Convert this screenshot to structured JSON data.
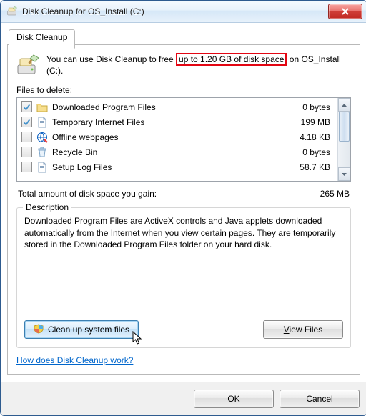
{
  "window": {
    "title": "Disk Cleanup for OS_Install (C:)"
  },
  "tab": {
    "label": "Disk Cleanup"
  },
  "intro": {
    "before": "You can use Disk Cleanup to free",
    "highlight": "up to 1.20 GB of disk space",
    "after": "on OS_Install (C:)."
  },
  "files_label": "Files to delete:",
  "items": [
    {
      "name": "Downloaded Program Files",
      "size": "0 bytes",
      "checked": true,
      "icon": "folder"
    },
    {
      "name": "Temporary Internet Files",
      "size": "199 MB",
      "checked": true,
      "icon": "page"
    },
    {
      "name": "Offline webpages",
      "size": "4.18 KB",
      "checked": false,
      "icon": "offline"
    },
    {
      "name": "Recycle Bin",
      "size": "0 bytes",
      "checked": false,
      "icon": "bin"
    },
    {
      "name": "Setup Log Files",
      "size": "58.7 KB",
      "checked": false,
      "icon": "page"
    }
  ],
  "totals": {
    "label": "Total amount of disk space you gain:",
    "value": "265 MB"
  },
  "description": {
    "legend": "Description",
    "text": "Downloaded Program Files are ActiveX controls and Java applets downloaded automatically from the Internet when you view certain pages. They are temporarily stored in the Downloaded Program Files folder on your hard disk."
  },
  "buttons": {
    "clean_system": "Clean up system files",
    "view_files_pre": "",
    "view_files": "View Files",
    "ok": "OK",
    "cancel": "Cancel"
  },
  "link": "How does Disk Cleanup work?"
}
